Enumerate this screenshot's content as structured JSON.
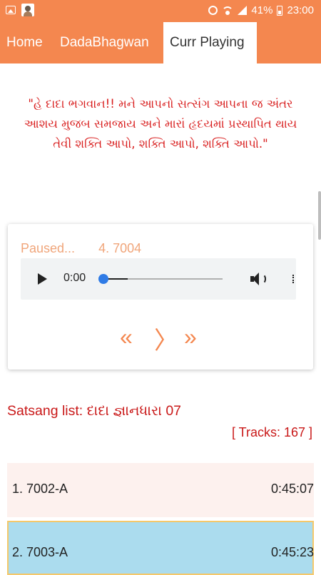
{
  "status_bar": {
    "battery_percent": "41%",
    "time": "23:00",
    "icons": [
      "gallery-icon",
      "avatar-icon",
      "alarm-icon",
      "wifi-icon",
      "signal-icon",
      "battery-icon"
    ]
  },
  "tabs": [
    {
      "label": "Home",
      "active": false
    },
    {
      "label": "DadaBhagwan",
      "active": false
    },
    {
      "label": "Curr Playing",
      "active": true
    }
  ],
  "quote": "\"હે દાદા ભગવાન!! મને આપનો સત્સંગ આપના જ અંતર આશય મુજબ સમજાય અને મારાં હૃદયમાં પ્રસ્થાપિત થાય તેવી શક્તિ આપો, શક્તિ આપો, શક્તિ આપો.\"",
  "player": {
    "status": "Paused...",
    "current_track": "4. 7004",
    "time": "0:00",
    "progress_fraction": 0,
    "nav": {
      "prev": "«",
      "next": "〉",
      "ffwd": "»"
    }
  },
  "satsang_list": {
    "title": "Satsang list: દાદા જ્ઞાનધારા 07",
    "tracks_count": "[ Tracks: 167 ]",
    "items": [
      {
        "name": "1. 7002-A",
        "duration": "0:45:07"
      },
      {
        "name": "2. 7003-A",
        "duration": "0:45:23"
      }
    ]
  },
  "colors": {
    "accent": "#f4874f",
    "quote_text": "#d81b1b",
    "list_text": "#c91818",
    "selected_row": "#abdcee"
  }
}
